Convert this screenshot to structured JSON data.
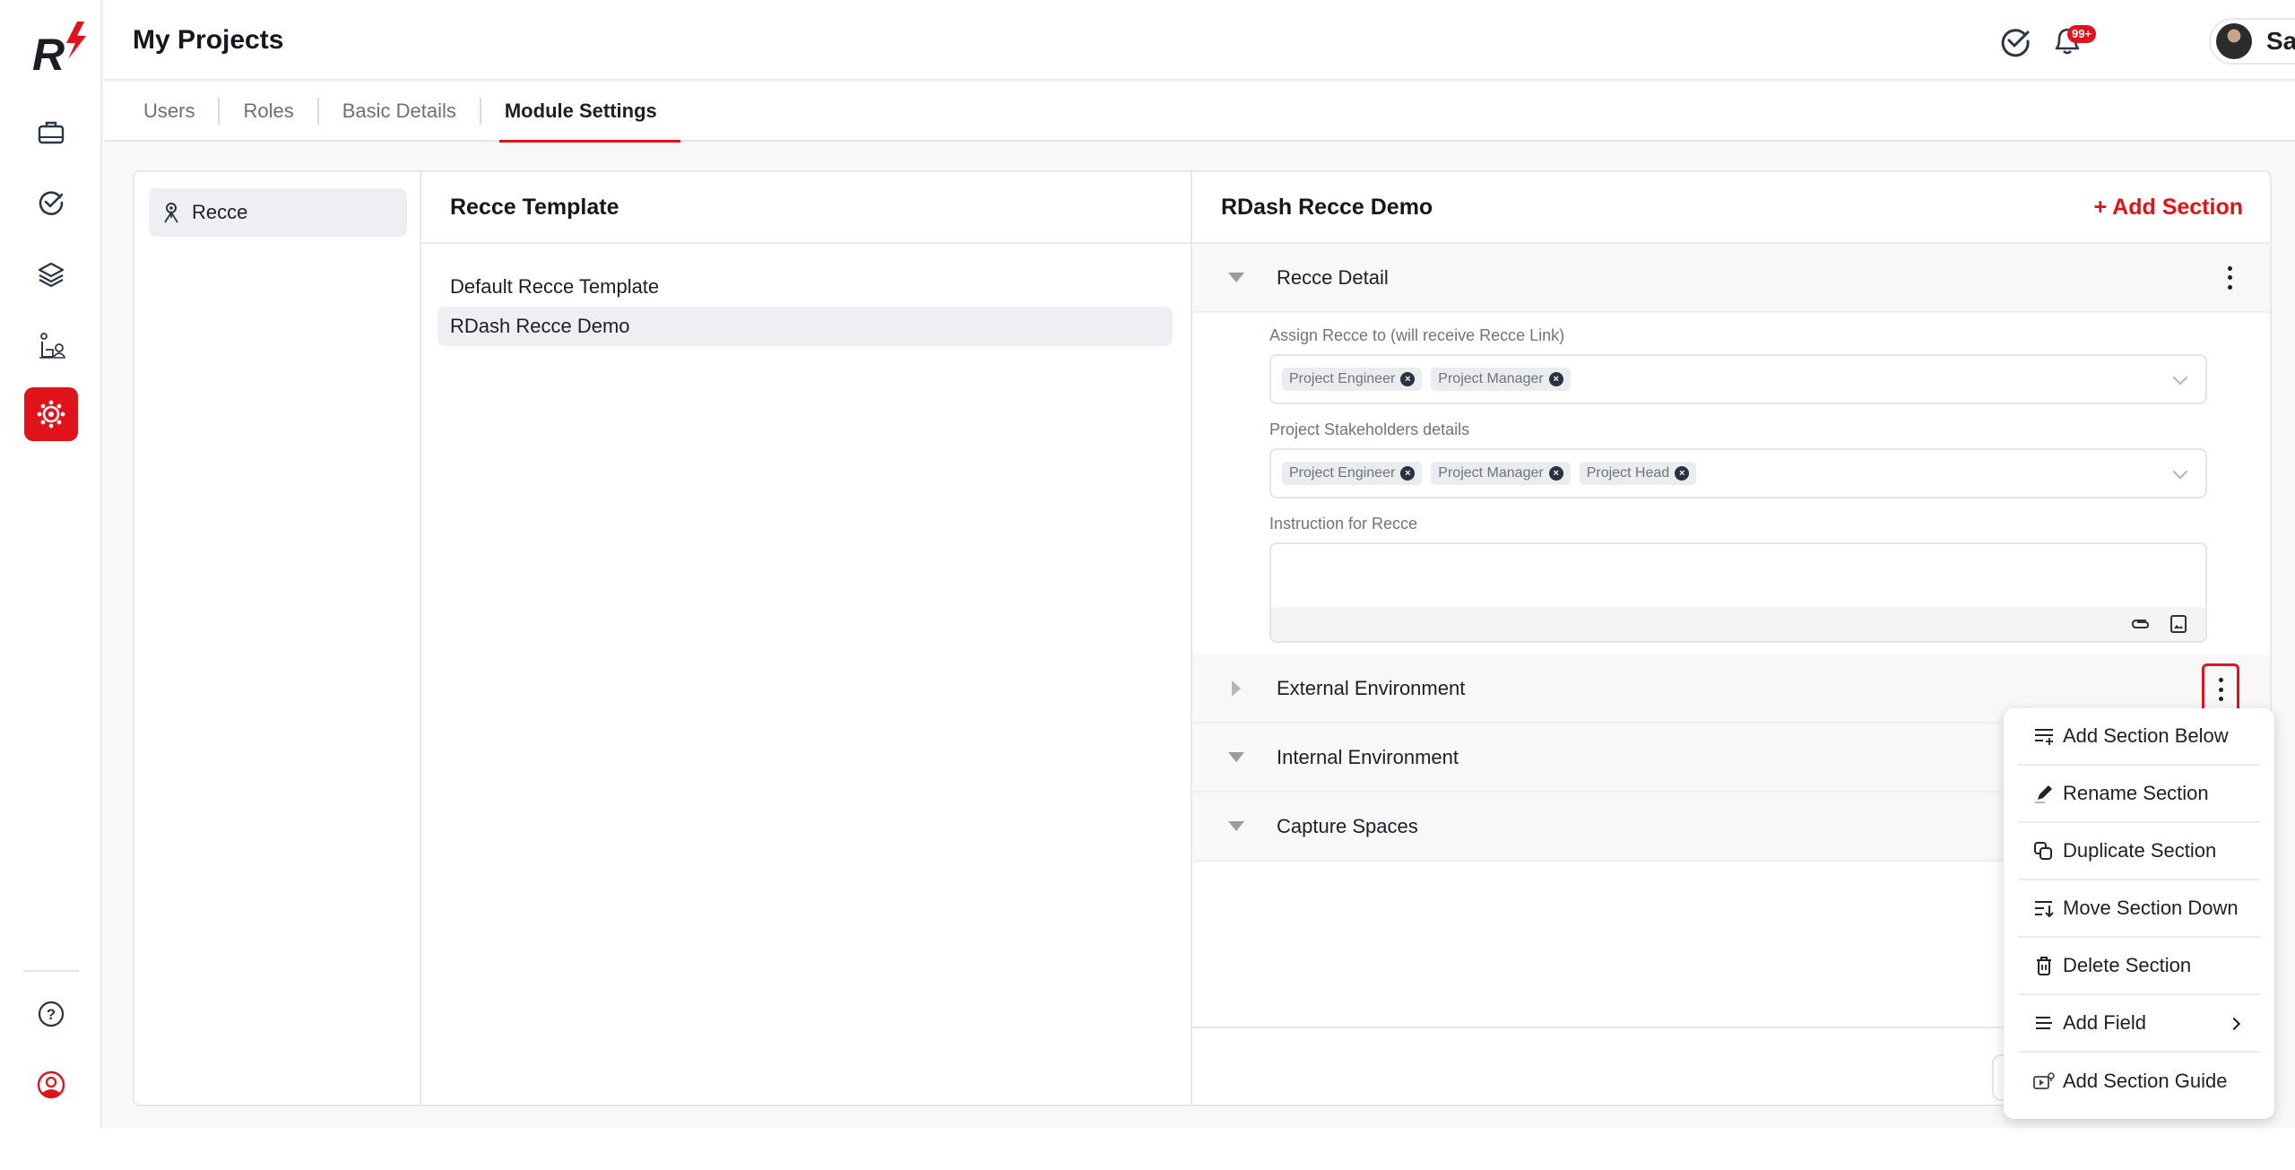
{
  "header": {
    "title": "My Projects",
    "notifications_badge": "99+",
    "user_name": "Sagar"
  },
  "sidebar": {
    "items": [
      {
        "name": "projects",
        "icon": "briefcase-icon"
      },
      {
        "name": "tasks",
        "icon": "check-circle-icon"
      },
      {
        "name": "layers",
        "icon": "layers-icon"
      },
      {
        "name": "site-survey",
        "icon": "people-desk-icon"
      },
      {
        "name": "settings",
        "icon": "gear-icon",
        "active": true
      }
    ],
    "bottom": [
      {
        "name": "help",
        "icon": "help-circle-icon"
      },
      {
        "name": "support",
        "icon": "support-agent-icon"
      }
    ]
  },
  "tabs": [
    {
      "label": "Users",
      "active": false
    },
    {
      "label": "Roles",
      "active": false
    },
    {
      "label": "Basic Details",
      "active": false
    },
    {
      "label": "Module Settings",
      "active": true
    }
  ],
  "modules": {
    "items": [
      {
        "label": "Recce",
        "selected": true
      }
    ]
  },
  "templates": {
    "title": "Recce Template",
    "items": [
      {
        "label": "Default Recce Template",
        "selected": false
      },
      {
        "label": "RDash Recce Demo",
        "selected": true
      }
    ]
  },
  "editor": {
    "title": "RDash Recce Demo",
    "add_section_label": "+ Add Section",
    "sections": [
      {
        "name": "Recce Detail",
        "expanded": true
      },
      {
        "name": "External Environment",
        "expanded": false
      },
      {
        "name": "Internal Environment",
        "expanded": true
      },
      {
        "name": "Capture Spaces",
        "expanded": true
      }
    ],
    "fields": {
      "assign": {
        "label": "Assign Recce to (will receive Recce Link)",
        "chips": [
          "Project Engineer",
          "Project Manager"
        ]
      },
      "stakeholders": {
        "label": "Project Stakeholders details",
        "chips": [
          "Project Engineer",
          "Project Manager",
          "Project Head"
        ]
      },
      "instruction": {
        "label": "Instruction for Recce",
        "value": ""
      }
    }
  },
  "context_menu": {
    "items": [
      {
        "label": "Add Section Below",
        "icon": "add-below-icon"
      },
      {
        "label": "Rename Section",
        "icon": "pencil-icon"
      },
      {
        "label": "Duplicate Section",
        "icon": "duplicate-icon"
      },
      {
        "label": "Move Section Down",
        "icon": "move-down-icon"
      },
      {
        "label": "Delete Section",
        "icon": "trash-icon"
      },
      {
        "label": "Add Field",
        "icon": "lines-icon",
        "has_submenu": true
      },
      {
        "label": "Add Section Guide",
        "icon": "guide-video-icon"
      }
    ]
  },
  "colors": {
    "accent": "#e0131b",
    "text": "#1c1f26",
    "muted": "#6b6f79"
  }
}
